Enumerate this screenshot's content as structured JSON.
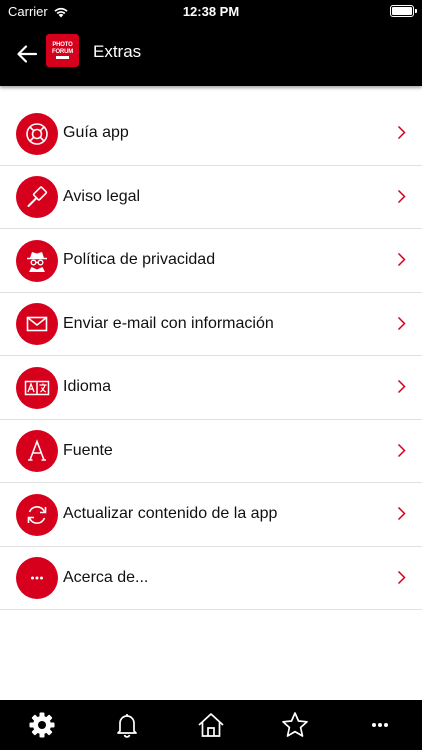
{
  "status_bar": {
    "carrier": "Carrier",
    "time": "12:38 PM"
  },
  "header": {
    "title": "Extras",
    "logo_lines": [
      "PHOTO",
      "FORUM"
    ]
  },
  "menu": {
    "items": [
      {
        "label": "Guía app",
        "icon": "lifebuoy-icon"
      },
      {
        "label": "Aviso legal",
        "icon": "gavel-icon"
      },
      {
        "label": "Política de privacidad",
        "icon": "spy-icon"
      },
      {
        "label": "Enviar e-mail con información",
        "icon": "envelope-icon"
      },
      {
        "label": "Idioma",
        "icon": "translate-icon"
      },
      {
        "label": "Fuente",
        "icon": "font-icon"
      },
      {
        "label": "Actualizar contenido de la app",
        "icon": "refresh-icon"
      },
      {
        "label": "Acerca de...",
        "icon": "more-icon"
      }
    ]
  },
  "tab_bar": {
    "tabs": [
      "settings-icon",
      "bell-icon",
      "home-icon",
      "star-icon",
      "more-icon"
    ]
  },
  "colors": {
    "accent": "#d6001c",
    "bar_background": "#000000",
    "divider": "#e1e1e1"
  }
}
